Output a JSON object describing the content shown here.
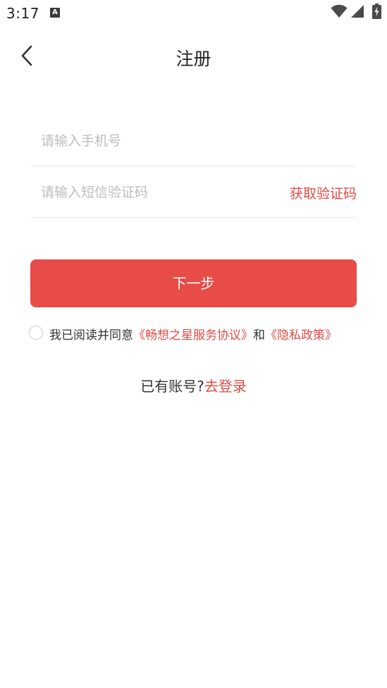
{
  "status_bar": {
    "time": "3:17",
    "notification_icon_label": "A",
    "icons": [
      "wifi-icon",
      "signal-icon",
      "battery-charging-icon"
    ]
  },
  "header": {
    "title": "注册",
    "back_icon": "chevron-left-icon"
  },
  "form": {
    "phone_placeholder": "请输入手机号",
    "phone_value": "",
    "code_placeholder": "请输入短信验证码",
    "code_value": "",
    "get_code_label": "获取验证码",
    "next_label": "下一步"
  },
  "agreement": {
    "checked": false,
    "prefix": "我已阅读并同意",
    "service_link": "《畅想之星服务协议》",
    "connector": "和",
    "privacy_link": "《隐私政策》"
  },
  "login": {
    "prompt": "已有账号?",
    "link": "去登录"
  },
  "colors": {
    "accent": "#e74c48",
    "link": "#e24b45",
    "placeholder": "#bdbdbd",
    "divider": "#e6e6e6"
  }
}
